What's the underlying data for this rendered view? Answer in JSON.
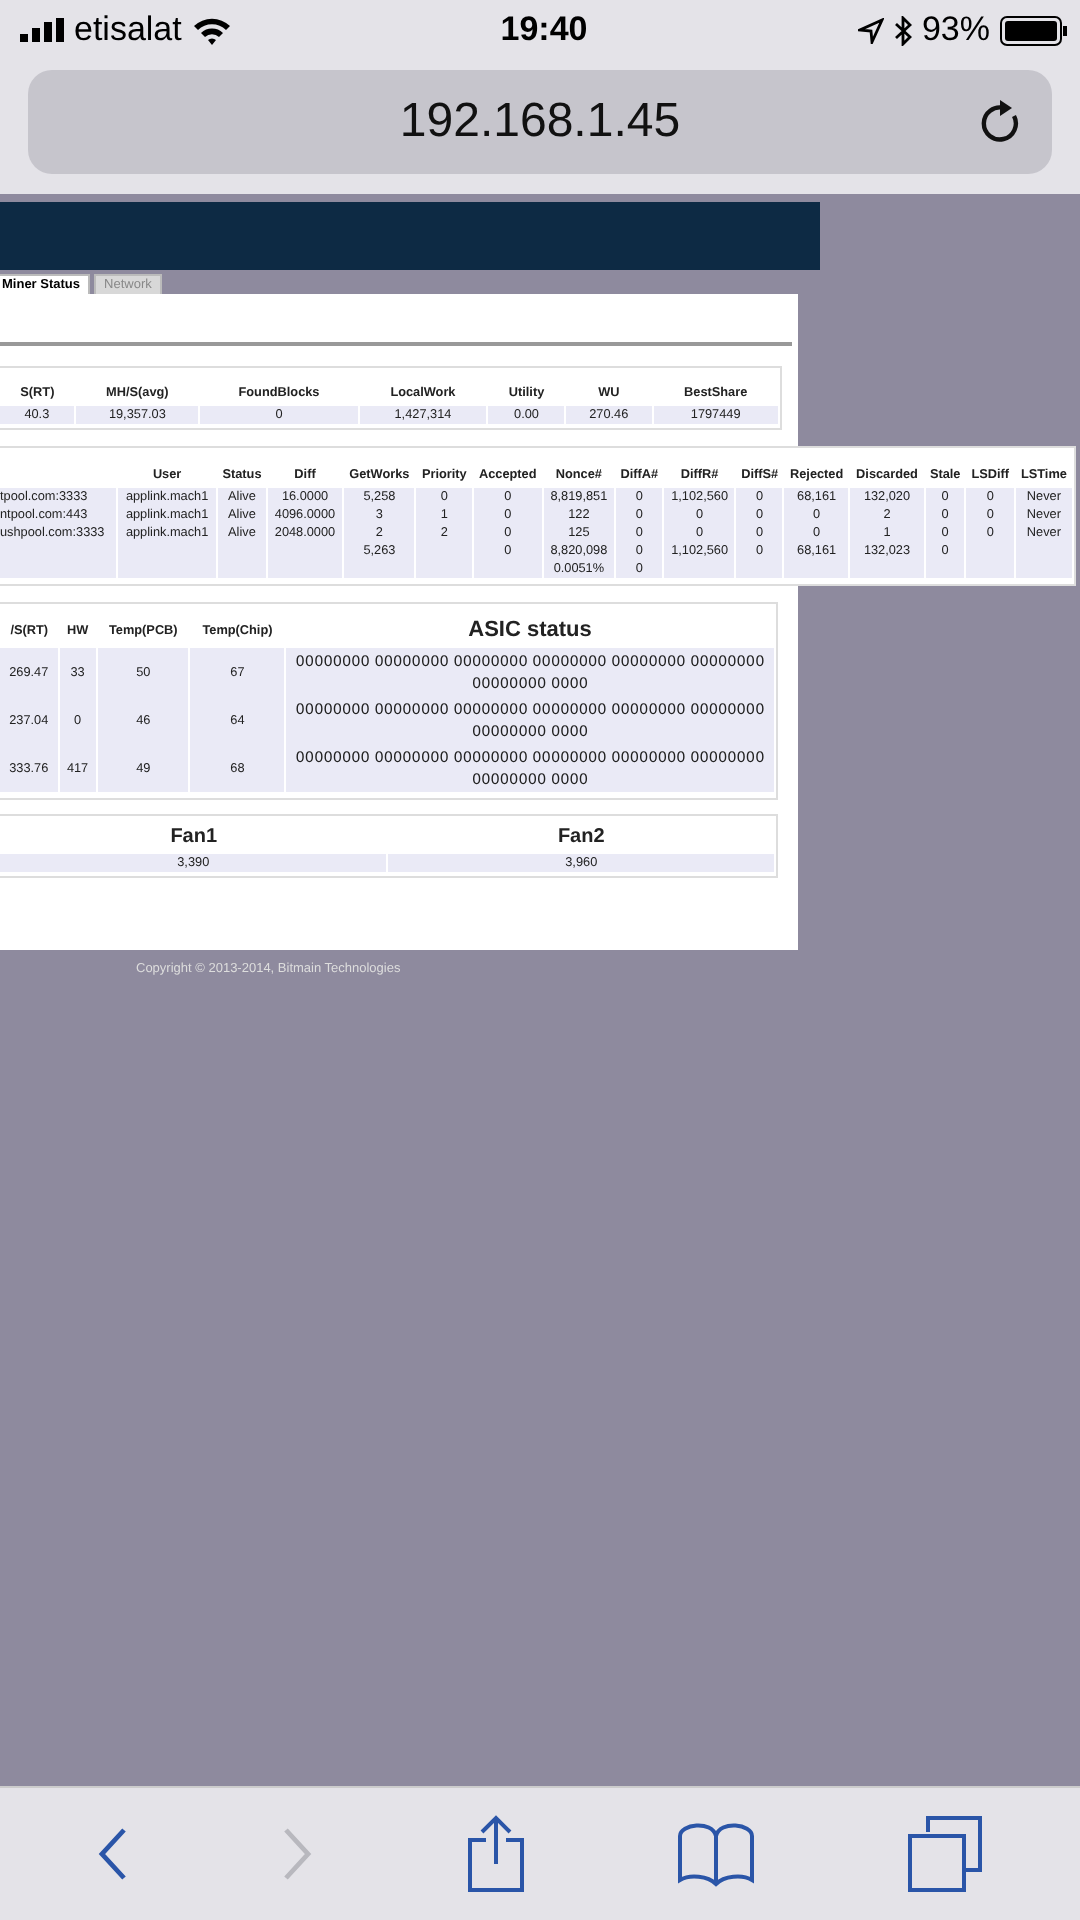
{
  "status_bar": {
    "carrier": "etisalat",
    "time": "19:40",
    "battery": "93%"
  },
  "address_bar": {
    "url": "192.168.1.45"
  },
  "tabs": [
    {
      "label": "Miner Status",
      "selected": true
    },
    {
      "label": "Network",
      "selected": false
    }
  ],
  "summary": {
    "columns": [
      "S(RT)",
      "MH/S(avg)",
      "FoundBlocks",
      "LocalWork",
      "Utility",
      "WU",
      "BestShare"
    ],
    "rows": [
      [
        "40.3",
        "19,357.03",
        "0",
        "1,427,314",
        "0.00",
        "270.46",
        "1797449"
      ]
    ]
  },
  "pools": {
    "columns": [
      null,
      "User",
      "Status",
      "Diff",
      "GetWorks",
      "Priority",
      "Accepted",
      "Nonce#",
      "DiffA#",
      "DiffR#",
      "DiffS#",
      "Rejected",
      "Discarded",
      "Stale",
      "LSDiff",
      "LSTime"
    ],
    "rows": [
      [
        "tpool.com:3333",
        "applink.mach1",
        "Alive",
        "16.0000",
        "5,258",
        "0",
        "0",
        "8,819,851",
        "0",
        "1,102,560",
        "0",
        "68,161",
        "132,020",
        "0",
        "0",
        "Never"
      ],
      [
        "ntpool.com:443",
        "applink.mach1",
        "Alive",
        "4096.0000",
        "3",
        "1",
        "0",
        "122",
        "0",
        "0",
        "0",
        "0",
        "2",
        "0",
        "0",
        "Never"
      ],
      [
        "ushpool.com:3333",
        "applink.mach1",
        "Alive",
        "2048.0000",
        "2",
        "2",
        "0",
        "125",
        "0",
        "0",
        "0",
        "0",
        "1",
        "0",
        "0",
        "Never"
      ],
      [
        null,
        null,
        null,
        null,
        "5,263",
        null,
        "0",
        "8,820,098",
        "0",
        "1,102,560",
        "0",
        "68,161",
        "132,023",
        "0",
        null,
        null
      ],
      [
        null,
        null,
        null,
        null,
        null,
        null,
        null,
        "0.0051%",
        "0",
        null,
        null,
        null,
        null,
        null,
        null,
        null
      ]
    ]
  },
  "devices": {
    "columns": [
      "/S(RT)",
      "HW",
      "Temp(PCB)",
      "Temp(Chip)",
      "ASIC status"
    ],
    "rows": [
      [
        "269.47",
        "33",
        "50",
        "67",
        "00000000 00000000 00000000 00000000 00000000 00000000 00000000 0000"
      ],
      [
        "237.04",
        "0",
        "46",
        "64",
        "00000000 00000000 00000000 00000000 00000000 00000000 00000000 0000"
      ],
      [
        "333.76",
        "417",
        "49",
        "68",
        "00000000 00000000 00000000 00000000 00000000 00000000 00000000 0000"
      ]
    ]
  },
  "fans": {
    "columns": [
      "Fan1",
      "Fan2"
    ],
    "rows": [
      [
        "3,390",
        "3,960"
      ]
    ]
  },
  "copyright": "Copyright © 2013-2014, Bitmain Technologies",
  "toolbar": [
    {
      "kind": "back",
      "disabled": false
    },
    {
      "kind": "forward",
      "disabled": true
    },
    {
      "kind": "share",
      "disabled": false
    },
    {
      "kind": "bookmarks",
      "disabled": false
    },
    {
      "kind": "tabs",
      "disabled": false
    }
  ]
}
